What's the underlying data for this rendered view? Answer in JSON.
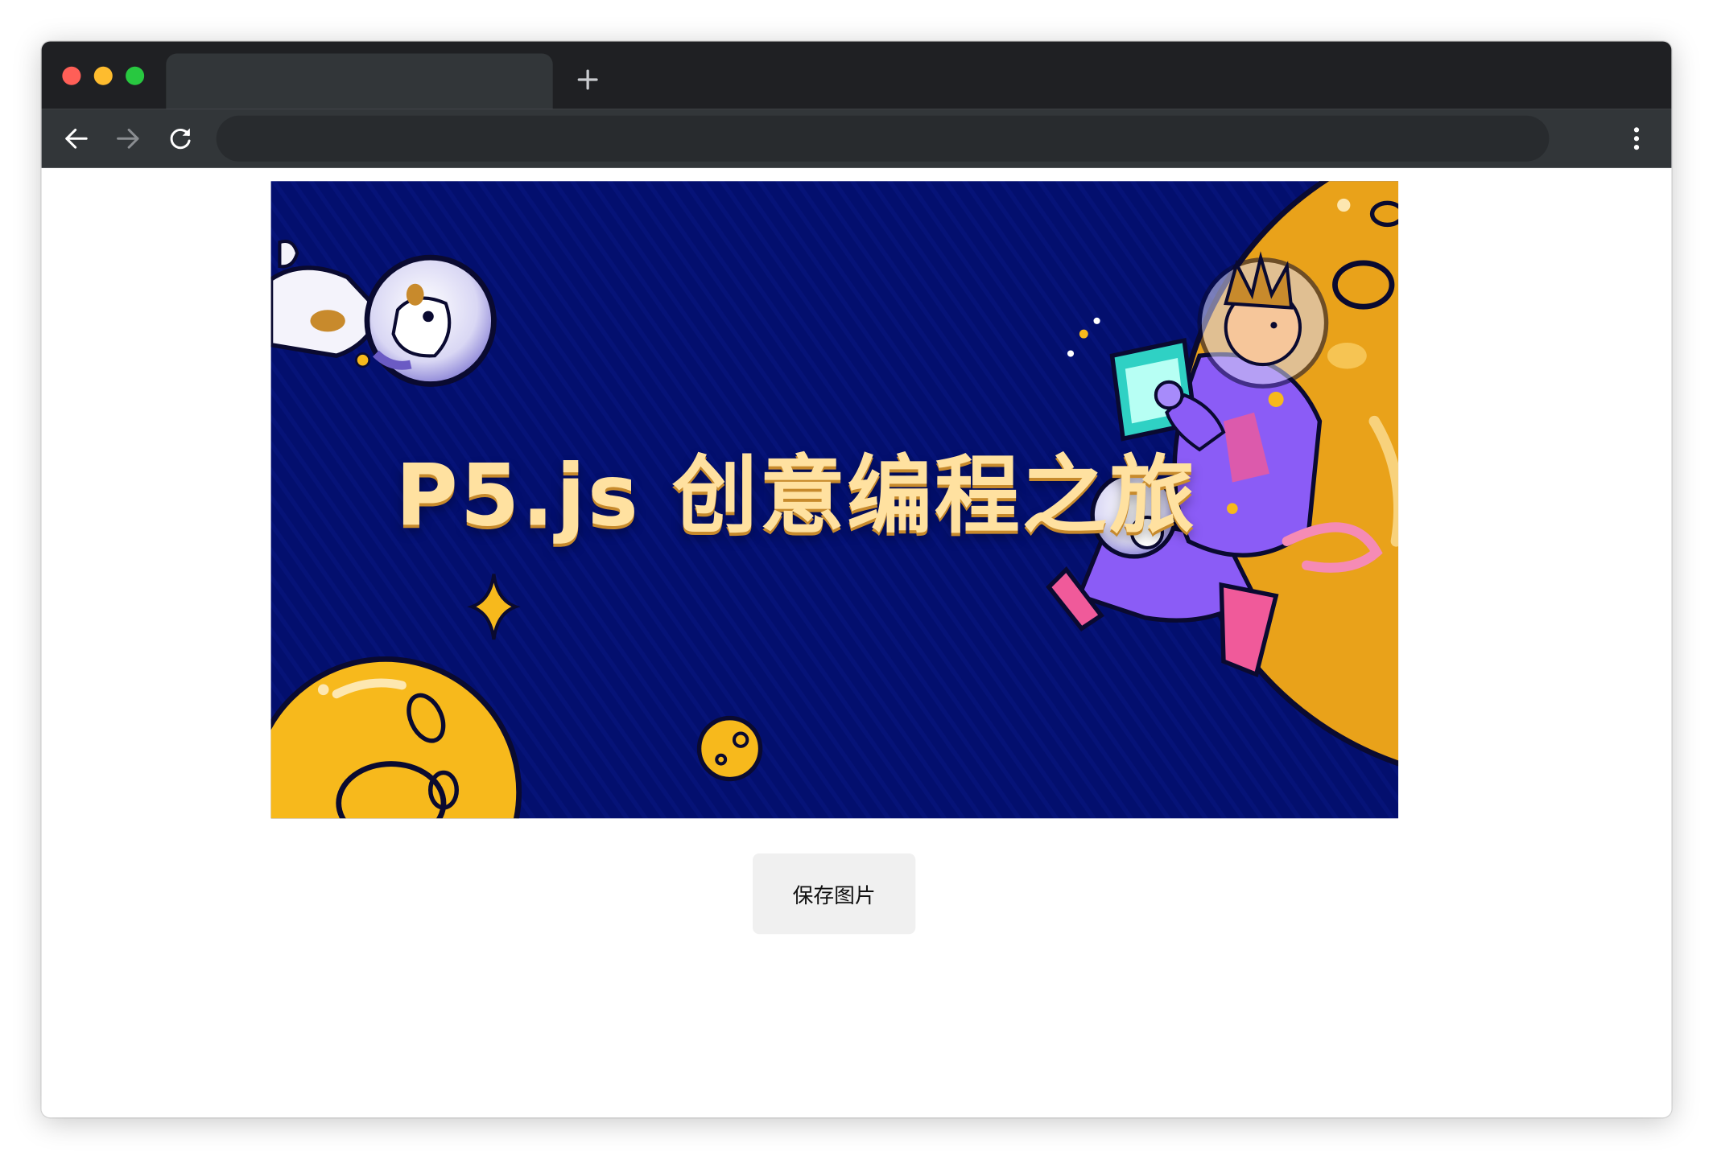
{
  "browser": {
    "traffic_lights": {
      "close_color": "#ff5f57",
      "minimize_color": "#febc2e",
      "maximize_color": "#28c840"
    },
    "tab_title": "",
    "new_tab_icon": "plus-icon",
    "address_bar": {
      "value": ""
    },
    "nav_icons": [
      "back-arrow-icon",
      "forward-arrow-icon",
      "reload-icon"
    ],
    "menu_icon": "kebab-menu-icon"
  },
  "banner": {
    "title": "P5.js 创意编程之旅",
    "background_color": "#030f6e",
    "accent_color": "#f7b91c"
  },
  "actions": {
    "save_label": "保存图片"
  }
}
